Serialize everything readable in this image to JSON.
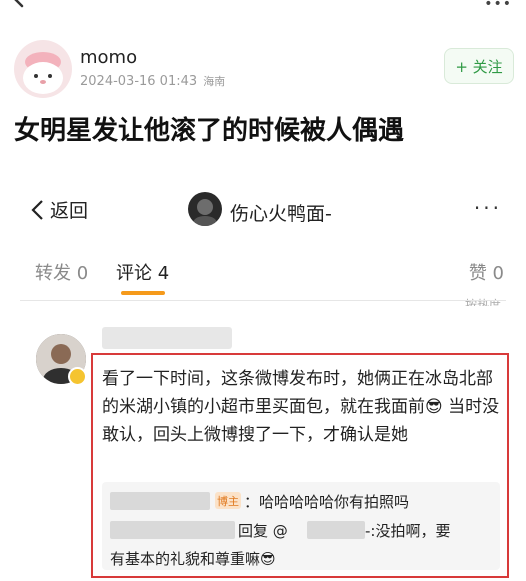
{
  "post": {
    "username": "momo",
    "date": "2024-03-16 01:43",
    "location": "海南",
    "follow_label": "+ 关注",
    "title": "女明星发让他滚了的时候被人偶遇"
  },
  "embedded": {
    "nav": {
      "back_label": "返回",
      "title": "伤心火鸭面-",
      "more": "···"
    },
    "tabs": [
      {
        "label": "转发 0"
      },
      {
        "label": "评论 4"
      },
      {
        "label": "赞 0"
      }
    ],
    "cut_text": "按热度",
    "comment": {
      "text": "看了一下时间，这条微博发布时，她俩正在冰岛北部的米湖小镇的小超市里买面包，就在我面前😎 当时没敢认，回头上微博搜了一下，才确认是她"
    },
    "replies": {
      "badge": "博主",
      "line1": "：哈哈哈哈哈你有拍照吗",
      "line2_prefix": "回复 @",
      "line2_suffix": "-:没拍啊，要",
      "line3": "有基本的礼貌和尊重嘛😎"
    }
  },
  "colors": {
    "accent_orange": "#f59a1b",
    "follow_green": "#2f9a45",
    "highlight_red": "#d83a3a"
  },
  "icons": [
    "back-arrow-icon",
    "more-icon",
    "chevron-left-icon",
    "verified-badge-icon"
  ]
}
